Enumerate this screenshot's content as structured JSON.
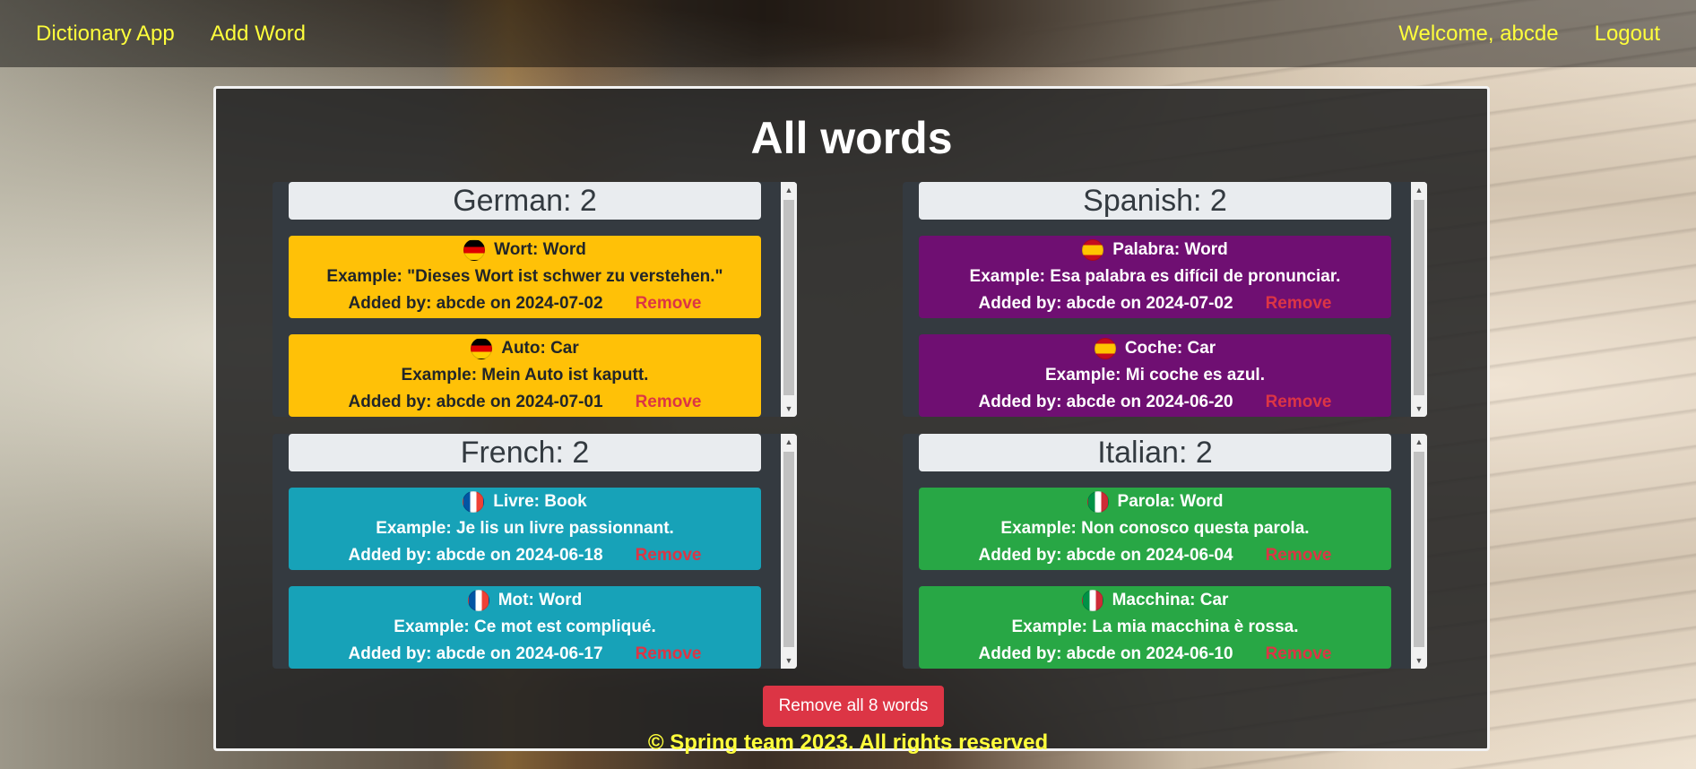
{
  "nav": {
    "brand": "Dictionary App",
    "add_word": "Add Word",
    "welcome": "Welcome, abcde",
    "logout": "Logout"
  },
  "main": {
    "title": "All words",
    "remove_all_label": "Remove all 8 words"
  },
  "languages": [
    {
      "header": "German: 2",
      "color": "#ffc107",
      "flag": "germany-flag-icon",
      "words": [
        {
          "word": "Wort: Word",
          "example": "Example: \"Dieses Wort ist schwer zu verstehen.\"",
          "added": "Added by: abcde on 2024-07-02",
          "remove": "Remove"
        },
        {
          "word": "Auto: Car",
          "example": "Example: Mein Auto ist kaputt.",
          "added": "Added by: abcde on 2024-07-01",
          "remove": "Remove"
        }
      ]
    },
    {
      "header": "Spanish: 2",
      "color": "#6f0f72",
      "flag": "spain-flag-icon",
      "words": [
        {
          "word": "Palabra: Word",
          "example": "Example: Esa palabra es difícil de pronunciar.",
          "added": "Added by: abcde on 2024-07-02",
          "remove": "Remove"
        },
        {
          "word": "Coche: Car",
          "example": "Example: Mi coche es azul.",
          "added": "Added by: abcde on 2024-06-20",
          "remove": "Remove"
        }
      ]
    },
    {
      "header": "French: 2",
      "color": "#17a2b8",
      "flag": "france-flag-icon",
      "words": [
        {
          "word": "Livre: Book",
          "example": "Example: Je lis un livre passionnant.",
          "added": "Added by: abcde on 2024-06-18",
          "remove": "Remove"
        },
        {
          "word": "Mot: Word",
          "example": "Example: Ce mot est compliqué.",
          "added": "Added by: abcde on 2024-06-17",
          "remove": "Remove"
        }
      ]
    },
    {
      "header": "Italian: 2",
      "color": "#28a745",
      "flag": "italy-flag-icon",
      "words": [
        {
          "word": "Parola: Word",
          "example": "Example: Non conosco questa parola.",
          "added": "Added by: abcde on 2024-06-04",
          "remove": "Remove"
        },
        {
          "word": "Macchina: Car",
          "example": "Example: La mia macchina è rossa.",
          "added": "Added by: abcde on 2024-06-10",
          "remove": "Remove"
        }
      ]
    }
  ],
  "footer": {
    "text": "© Spring team 2023. All rights reserved"
  }
}
